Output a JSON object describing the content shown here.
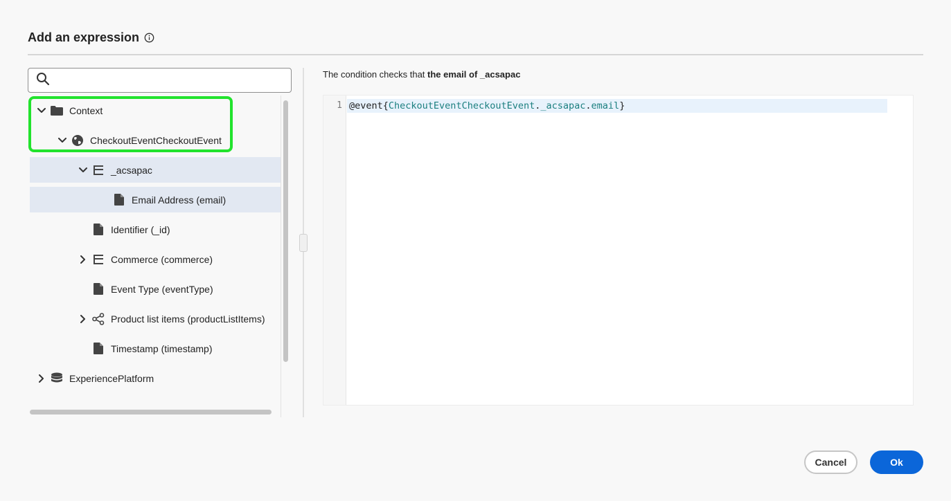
{
  "dialog": {
    "title": "Add an expression",
    "info_icon": "info-icon"
  },
  "search": {
    "placeholder": "",
    "value": "",
    "icon": "search-icon"
  },
  "tree": [
    {
      "label": "Context",
      "icon": "folder-icon",
      "chevron": "chevron-down-icon",
      "selected": false
    },
    {
      "label": "CheckoutEventCheckoutEvent",
      "icon": "globe-icon",
      "chevron": "chevron-down-icon",
      "selected": false
    },
    {
      "label": "_acsapac",
      "icon": "object-icon",
      "chevron": "chevron-down-icon",
      "selected": true
    },
    {
      "label": "Email Address (email)",
      "icon": "file-icon",
      "chevron": "",
      "selected": true
    },
    {
      "label": "Identifier (_id)",
      "icon": "file-icon",
      "chevron": "",
      "selected": false
    },
    {
      "label": "Commerce (commerce)",
      "icon": "object-icon",
      "chevron": "chevron-right-icon",
      "selected": false
    },
    {
      "label": "Event Type (eventType)",
      "icon": "file-icon",
      "chevron": "",
      "selected": false
    },
    {
      "label": "Product list items (productListItems)",
      "icon": "share-icon",
      "chevron": "chevron-right-icon",
      "selected": false
    },
    {
      "label": "Timestamp (timestamp)",
      "icon": "file-icon",
      "chevron": "",
      "selected": false
    },
    {
      "label": "ExperiencePlatform",
      "icon": "database-icon",
      "chevron": "chevron-right-icon",
      "selected": false
    }
  ],
  "condition": {
    "prefix": "The condition checks that ",
    "bold": "the email of _acsapac"
  },
  "editor": {
    "line_number": "1",
    "tokens": [
      {
        "text": "@event{",
        "kind": "plain"
      },
      {
        "text": "CheckoutEventCheckoutEvent",
        "kind": "id"
      },
      {
        "text": ".",
        "kind": "plain"
      },
      {
        "text": "_acsapac",
        "kind": "id"
      },
      {
        "text": ".",
        "kind": "plain"
      },
      {
        "text": "email",
        "kind": "id"
      },
      {
        "text": "}",
        "kind": "plain"
      }
    ]
  },
  "buttons": {
    "cancel": "Cancel",
    "ok": "Ok"
  },
  "colors": {
    "highlight": "#22e32d",
    "primary": "#0b66d9",
    "selected_row": "#e2e8f2"
  }
}
